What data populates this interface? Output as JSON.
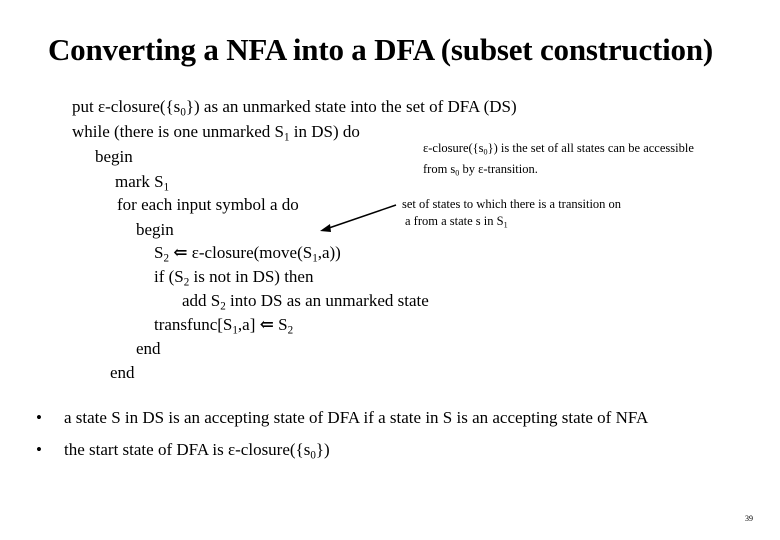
{
  "title": "Converting a NFA into a DFA (subset construction)",
  "algorithm": {
    "line1": {
      "pre": "put  ε-closure({s",
      "sub": "0",
      "post": "}) as an unmarked  state into the set of DFA (DS)"
    },
    "line2": {
      "pre": "while (there is one unmarked S",
      "sub": "1",
      "post": " in DS) do"
    },
    "line3": "begin",
    "line4": {
      "pre": "mark S",
      "sub": "1"
    },
    "line5": "for each input symbol a do",
    "line6": "begin",
    "line7": {
      "pre": "S",
      "sub": "2",
      "arrow": " ⇐ ",
      "post": "ε-closure(move(S",
      "sub2": "1",
      "post2": ",a))"
    },
    "line8": {
      "pre": "if (S",
      "sub": "2",
      "post": " is not in DS) then"
    },
    "line9": {
      "pre": "add S",
      "sub": "2",
      "post": " into DS as an unmarked state"
    },
    "line10": {
      "pre": "transfunc[S",
      "sub": "1",
      "post": ",a] ",
      "arrow": "⇐",
      "post2": " S",
      "sub2": "2"
    },
    "line11": "end",
    "line12": "end"
  },
  "notes": {
    "closure_note_line1": {
      "pre": "ε-closure({s",
      "sub": "0",
      "post": "})  is the set of all states can be accessible"
    },
    "closure_note_line2": {
      "pre": "from s",
      "sub": "0",
      "post": " by ε-transition."
    },
    "move_note_line1": "set of states to which there is a transition on",
    "move_note_line2": {
      "pre": "a from a state s in S",
      "sub": "1"
    }
  },
  "bullets": [
    {
      "text": "a state S in DS is an accepting state of DFA if  a state in S is an accepting state of NFA"
    },
    {
      "pre": "the start state of DFA is ε-closure({s",
      "sub": "0",
      "post": "})"
    }
  ],
  "bullet_symbol": "•",
  "page_number": "39"
}
